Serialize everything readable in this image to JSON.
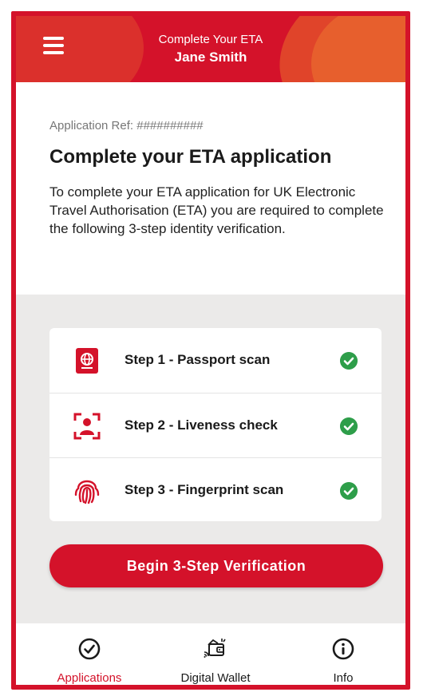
{
  "header": {
    "subtitle": "Complete Your ETA",
    "name": "Jane Smith"
  },
  "main": {
    "ref": "Application Ref: ##########",
    "title": "Complete your ETA application",
    "description": "To complete your ETA application for UK Electronic Travel Authorisation (ETA) you are required to complete the following 3-step identity verification."
  },
  "steps": [
    {
      "label": "Step 1 - Passport scan",
      "icon": "passport-icon",
      "status": "complete"
    },
    {
      "label": "Step 2 - Liveness check",
      "icon": "face-scan-icon",
      "status": "complete"
    },
    {
      "label": "Step 3 - Fingerprint scan",
      "icon": "fingerprint-icon",
      "status": "complete"
    }
  ],
  "actions": {
    "begin_label": "Begin 3-Step Verification"
  },
  "nav": {
    "items": [
      {
        "label": "Applications",
        "icon": "check-circle-icon",
        "active": true
      },
      {
        "label": "Digital Wallet",
        "icon": "wallet-icon",
        "active": false
      },
      {
        "label": "Info",
        "icon": "info-icon",
        "active": false
      }
    ]
  },
  "colors": {
    "brand_red": "#d4122a",
    "success_green": "#2e9e4a",
    "background_grey": "#ebeae9"
  }
}
